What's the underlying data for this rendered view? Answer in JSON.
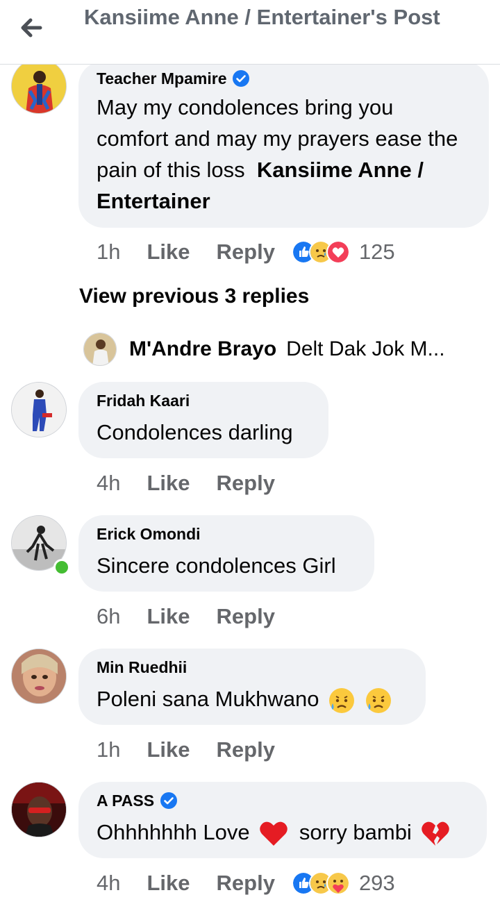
{
  "header": {
    "title": "Kansiime Anne / Entertainer's Post"
  },
  "comments": [
    {
      "author": "Teacher Mpamire",
      "verified": true,
      "text": "May my condolences bring you comfort and may my prayers ease the pain of this loss",
      "mention": "Kansiime Anne / Entertainer",
      "time": "1h",
      "like": "Like",
      "reply": "Reply",
      "reactions": [
        "like",
        "sad",
        "care"
      ],
      "reaction_count": "125"
    },
    {
      "author": "Fridah Kaari",
      "text": "Condolences darling",
      "time": "4h",
      "like": "Like",
      "reply": "Reply"
    },
    {
      "author": "Erick Omondi",
      "online": true,
      "text": "Sincere condolences Girl",
      "time": "6h",
      "like": "Like",
      "reply": "Reply"
    },
    {
      "author": "Min Ruedhii",
      "text": "Poleni sana Mukhwano",
      "emojis": [
        "sad-but-relieved-face",
        "sad-but-relieved-face"
      ],
      "time": "1h",
      "like": "Like",
      "reply": "Reply"
    },
    {
      "author": "A PASS",
      "verified": true,
      "text_parts": [
        "Ohhhhhhh Love",
        "sorry bambi"
      ],
      "emojis": [
        "red-heart",
        "broken-heart"
      ],
      "time": "4h",
      "like": "Like",
      "reply": "Reply",
      "reactions": [
        "like",
        "sad",
        "care"
      ],
      "reaction_count": "293"
    }
  ],
  "view_previous": "View previous 3 replies",
  "reply_preview": {
    "author": "M'Andre Brayo",
    "snippet": "Delt Dak Jok M..."
  },
  "colors": {
    "bubble": "#f0f2f5",
    "secondary_text": "#65676b",
    "verified": "#1877f2",
    "online": "#44bd32"
  }
}
